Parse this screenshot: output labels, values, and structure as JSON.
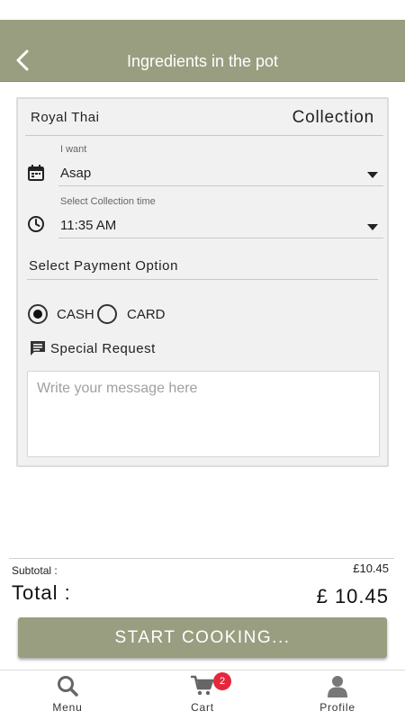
{
  "header": {
    "title": "Ingredients in the pot",
    "background": "#9a9e80"
  },
  "order": {
    "restaurant": "Royal Thai",
    "type": "Collection"
  },
  "when": {
    "label": "I want",
    "value": "Asap",
    "icon": "calendar-icon"
  },
  "time": {
    "label": "Select Collection time",
    "value": "11:35 AM",
    "icon": "clock-icon"
  },
  "payment": {
    "title": "Select Payment Option",
    "options": [
      {
        "label": "CASH",
        "selected": true
      },
      {
        "label": "CARD",
        "selected": false
      }
    ]
  },
  "special_request": {
    "title": "Special Request",
    "placeholder": "Write your message here",
    "icon": "message-icon"
  },
  "totals": {
    "subtotal_label": "Subtotal :",
    "subtotal_value": "£10.45",
    "total_label": "Total :",
    "total_value": "£ 10.45"
  },
  "cta": {
    "label": "START COOKING..."
  },
  "nav": {
    "items": [
      {
        "label": "Menu",
        "icon": "search-icon"
      },
      {
        "label": "Cart",
        "icon": "cart-icon",
        "badge": "2"
      },
      {
        "label": "Profile",
        "icon": "profile-icon"
      }
    ]
  },
  "colors": {
    "accent": "#9a9e80",
    "badge": "#e5273c"
  }
}
